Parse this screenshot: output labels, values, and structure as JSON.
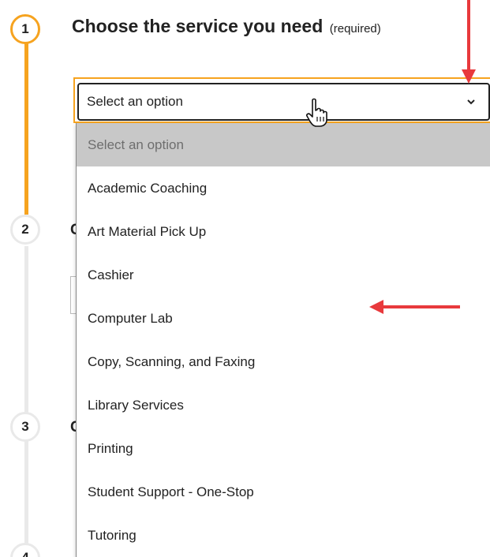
{
  "steps": [
    {
      "number": "1",
      "state": "active"
    },
    {
      "number": "2",
      "state": "inactive"
    },
    {
      "number": "3",
      "state": "inactive"
    },
    {
      "number": "4",
      "state": "inactive"
    }
  ],
  "heading": {
    "title": "Choose the service you need",
    "required_note": "(required)"
  },
  "service_select": {
    "value": "Select an option",
    "options": [
      "Select an option",
      "Academic Coaching",
      "Art Material Pick Up",
      "Cashier",
      "Computer Lab",
      "Copy, Scanning, and Faxing",
      "Library Services",
      "Printing",
      "Student Support - One-Stop",
      "Tutoring"
    ]
  },
  "colors": {
    "accent": "#f6a31f",
    "annotation_arrow": "#e8393c",
    "inactive_rail": "#e9e9e9",
    "highlighted_option_bg": "#c8c8c8"
  },
  "icons": {
    "dropdown": "chevron-down-icon",
    "cursor": "hand-pointer-icon",
    "annotations": [
      "arrow-down-icon",
      "arrow-left-icon"
    ]
  }
}
